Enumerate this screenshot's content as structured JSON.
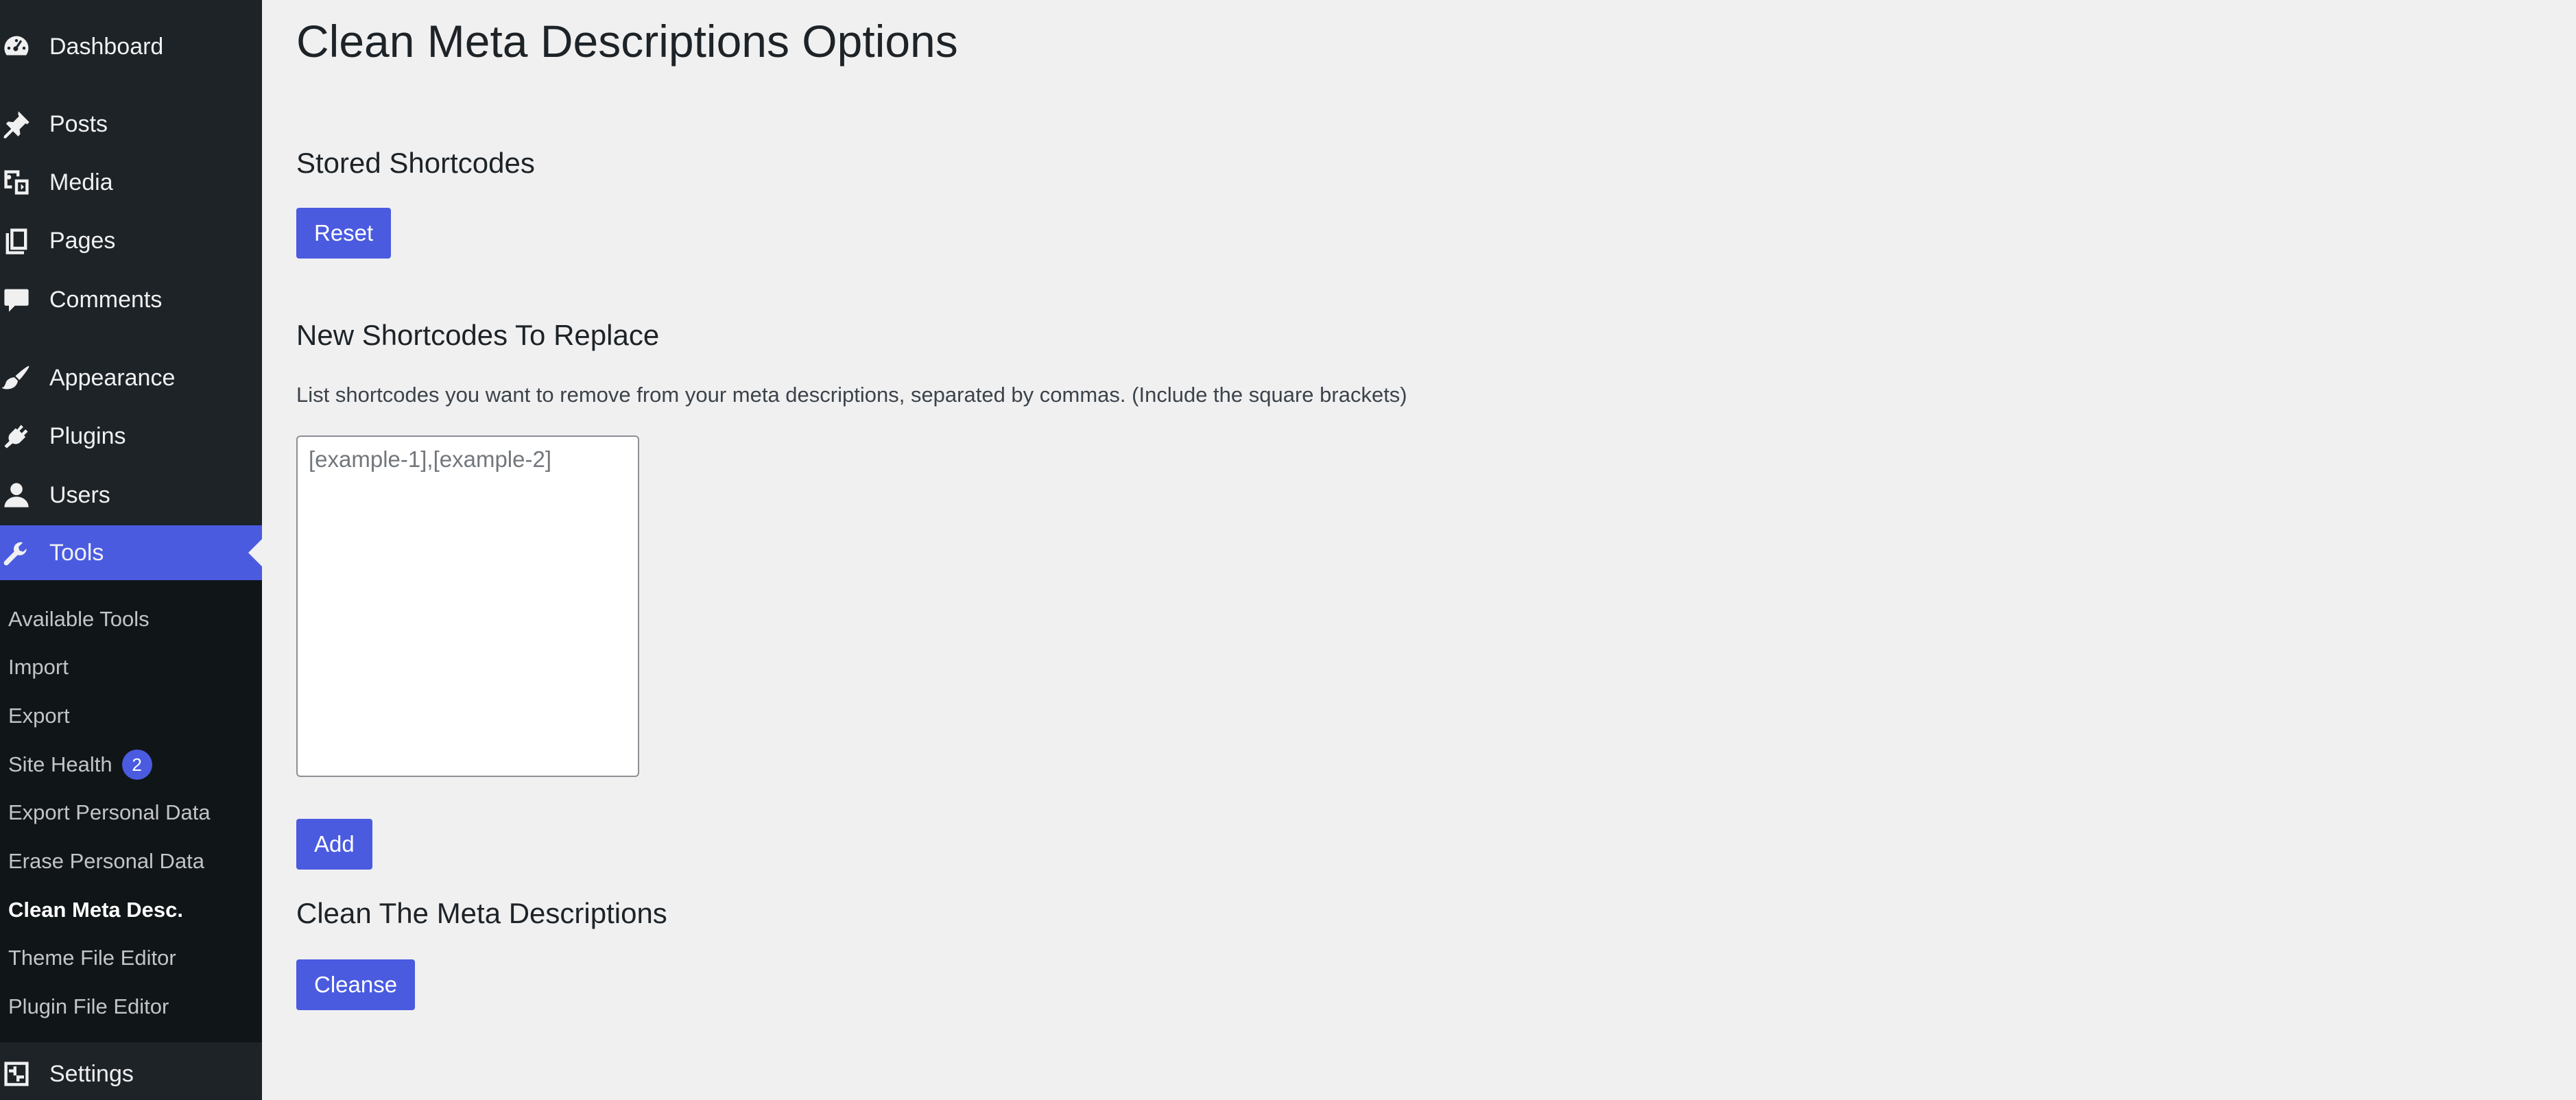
{
  "sidebar": {
    "menu": {
      "dashboard": {
        "label": "Dashboard",
        "icon": "dashboard-icon"
      },
      "posts": {
        "label": "Posts",
        "icon": "pushpin-icon"
      },
      "media": {
        "label": "Media",
        "icon": "media-icon"
      },
      "pages": {
        "label": "Pages",
        "icon": "pages-icon"
      },
      "comments": {
        "label": "Comments",
        "icon": "comment-icon"
      },
      "appearance": {
        "label": "Appearance",
        "icon": "paintbrush-icon"
      },
      "plugins": {
        "label": "Plugins",
        "icon": "plug-icon"
      },
      "users": {
        "label": "Users",
        "icon": "user-icon"
      },
      "tools": {
        "label": "Tools",
        "icon": "wrench-icon",
        "active": true
      },
      "settings": {
        "label": "Settings",
        "icon": "settings-sliders-icon"
      }
    },
    "tools_submenu": [
      {
        "label": "Available Tools"
      },
      {
        "label": "Import"
      },
      {
        "label": "Export"
      },
      {
        "label": "Site Health",
        "badge": "2"
      },
      {
        "label": "Export Personal Data"
      },
      {
        "label": "Erase Personal Data"
      },
      {
        "label": "Clean Meta Desc.",
        "current": true
      },
      {
        "label": "Theme File Editor"
      },
      {
        "label": "Plugin File Editor"
      }
    ]
  },
  "main": {
    "page_title": "Clean Meta Descriptions Options",
    "stored": {
      "heading": "Stored Shortcodes",
      "reset_label": "Reset"
    },
    "new_shortcodes": {
      "heading": "New Shortcodes To Replace",
      "description": "List shortcodes you want to remove from your meta descriptions, separated by commas. (Include the square brackets)",
      "placeholder": "[example-1],[example-2]",
      "value": "",
      "add_label": "Add"
    },
    "clean": {
      "heading": "Clean The Meta Descriptions",
      "cleanse_label": "Cleanse"
    }
  },
  "colors": {
    "sidebar_bg": "#1d2327",
    "submenu_bg": "#101517",
    "accent": "#4a5be0",
    "page_bg": "#f0f0f1"
  }
}
